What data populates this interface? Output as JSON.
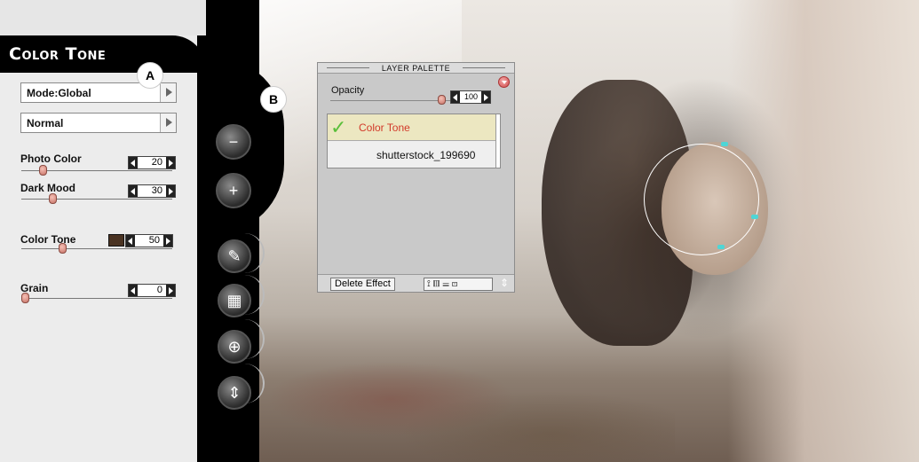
{
  "panel": {
    "title": "Color Tone",
    "mode_dropdown": "Mode:Global",
    "blend_dropdown": "Normal",
    "params": [
      {
        "label": "Photo Color",
        "value": "20",
        "level": 0.12
      },
      {
        "label": "Dark Mood",
        "value": "30",
        "level": 0.19
      },
      {
        "label": "Color Tone",
        "value": "50",
        "level": 0.27
      },
      {
        "label": "Grain",
        "value": "0",
        "level": 0.0
      }
    ],
    "swatch_color": "#4a3322"
  },
  "callouts": {
    "a": "A",
    "b": "B"
  },
  "tools": {
    "remove_brush": "−",
    "add_brush": "+",
    "brush": "✎",
    "texture": "▦",
    "target": "⊕",
    "expand": "⇕"
  },
  "layer_palette": {
    "title": "LAYER PALETTE",
    "opacity_label": "Opacity",
    "opacity_value": "100",
    "opacity_level": 1.0,
    "layers": [
      {
        "name": "Color Tone",
        "checked": true,
        "check_glyph": "✓"
      },
      {
        "name": "shutterstock_199690",
        "checked": false
      }
    ],
    "delete_label": "Delete Effect",
    "tool_icons": "⟟▥☰⊡",
    "resize_glyph": "⇕"
  },
  "colors": {
    "panel_bg": "#ececec",
    "strip_bg": "#000000",
    "active_layer_text": "#d23a2a",
    "active_layer_bg": "#ece7c1",
    "selection_ring": "#ffffff",
    "selection_node": "#4fd6d6"
  }
}
